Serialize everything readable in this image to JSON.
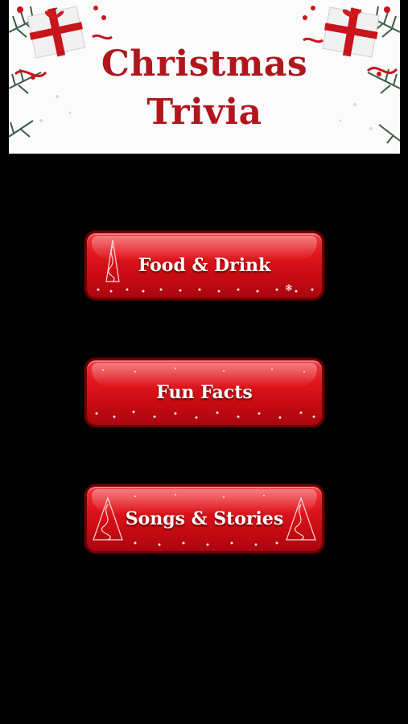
{
  "banner": {
    "title_line1": "Christmas",
    "title_line2": "Trivia"
  },
  "menu": {
    "buttons": [
      {
        "label": "Food & Drink"
      },
      {
        "label": "Fun Facts"
      },
      {
        "label": "Songs & Stories"
      }
    ]
  },
  "colors": {
    "background": "#000000",
    "banner": "#fbfbfb",
    "title": "#b0161c",
    "button_red": "#e0141c",
    "button_text": "#ffffff"
  },
  "icons": [
    "gift-box-icon",
    "pine-branch-icon",
    "christmas-tree-icon",
    "snowflake-icon"
  ]
}
